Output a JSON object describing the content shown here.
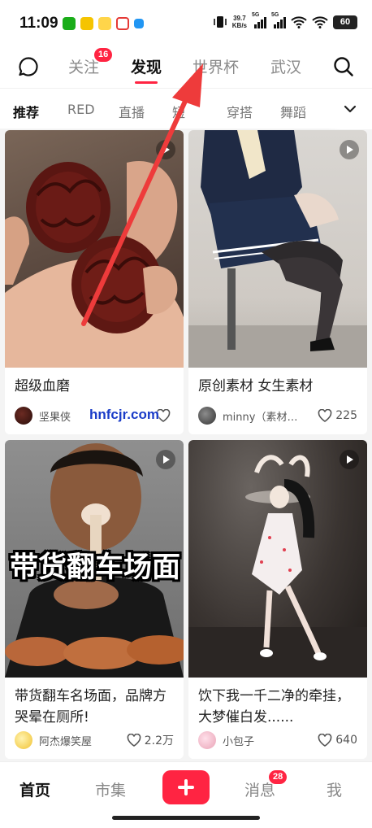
{
  "status_bar": {
    "time": "11:09",
    "net_speed_value": "39.7",
    "net_speed_unit": "KB/s",
    "sim1_label": "5G",
    "sim2_label": "5G",
    "battery": "60"
  },
  "top_tabs": [
    {
      "label": "关注",
      "badge": "16",
      "active": false
    },
    {
      "label": "发现",
      "active": true
    },
    {
      "label": "世界杯",
      "active": false
    },
    {
      "label": "武汉",
      "active": false
    }
  ],
  "categories": [
    {
      "label": "推荐",
      "active": true
    },
    {
      "label": "RED"
    },
    {
      "label": "直播"
    },
    {
      "label": "短"
    },
    {
      "label": "穿搭"
    },
    {
      "label": "舞蹈"
    }
  ],
  "feed": [
    {
      "title": "超级血磨",
      "author": "坚果侠",
      "likes": "",
      "video": true
    },
    {
      "title": "原创素材 女生素材",
      "author": "minny（素材…",
      "likes": "225",
      "video": true
    },
    {
      "title": "带货翻车名场面，品牌方哭晕在厕所!",
      "author": "阿杰爆笑屋",
      "likes": "2.2万",
      "video": true,
      "overlay": "带货翻车场面"
    },
    {
      "title": "饮下我一千二净的牵挂，大梦催白发......",
      "author": "小包子",
      "likes": "640",
      "video": true
    }
  ],
  "watermark": "hnfcjr.com",
  "bottom_nav": {
    "home": "首页",
    "market": "市集",
    "messages": "消息",
    "messages_badge": "28",
    "me": "我"
  },
  "colors": {
    "accent": "#ff2442",
    "annotation_arrow": "#ee3b3b"
  }
}
